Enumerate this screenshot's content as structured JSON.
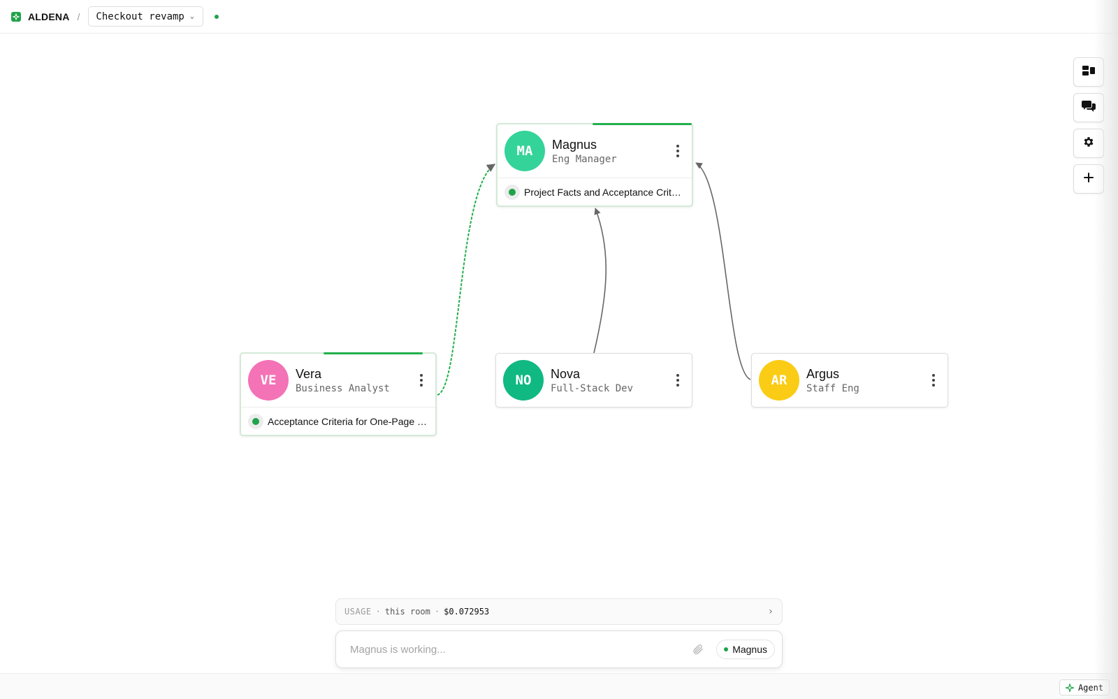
{
  "header": {
    "brand": "ALDENA",
    "separator": "/",
    "project": "Checkout revamp",
    "status_color": "#1fa34a"
  },
  "nodes": [
    {
      "id": "magnus",
      "initials": "MA",
      "name": "Magnus",
      "role": "Eng Manager",
      "color": "#34d399",
      "working": true,
      "task": "Project Facts and Acceptance Criteria"
    },
    {
      "id": "vera",
      "initials": "VE",
      "name": "Vera",
      "role": "Business Analyst",
      "color": "#f472b6",
      "working": true,
      "task": "Acceptance Criteria for One-Page Checkout"
    },
    {
      "id": "nova",
      "initials": "NO",
      "name": "Nova",
      "role": "Full-Stack Dev",
      "color": "#10b981",
      "working": false,
      "task": ""
    },
    {
      "id": "argus",
      "initials": "AR",
      "name": "Argus",
      "role": "Staff Eng",
      "color": "#facc15",
      "working": false,
      "task": ""
    }
  ],
  "edges": [
    {
      "from": "vera",
      "to": "magnus",
      "active": true
    },
    {
      "from": "nova",
      "to": "magnus",
      "active": false
    },
    {
      "from": "argus",
      "to": "magnus",
      "active": false
    }
  ],
  "toolbar": {
    "items": [
      {
        "name": "layout-icon"
      },
      {
        "name": "chat-icon"
      },
      {
        "name": "gear-icon"
      },
      {
        "name": "plus-icon"
      }
    ]
  },
  "usage": {
    "label": "USAGE",
    "sep": "·",
    "scope": "this room",
    "cost": "$0.072953",
    "chevron": "›"
  },
  "composer": {
    "placeholder": "Magnus is working...",
    "agent": "Magnus"
  },
  "bottombar": {
    "agent_label": "Agent"
  },
  "colors": {
    "accent": "#1fa34a",
    "edge": "#666666",
    "edge_active": "#22b04c"
  }
}
